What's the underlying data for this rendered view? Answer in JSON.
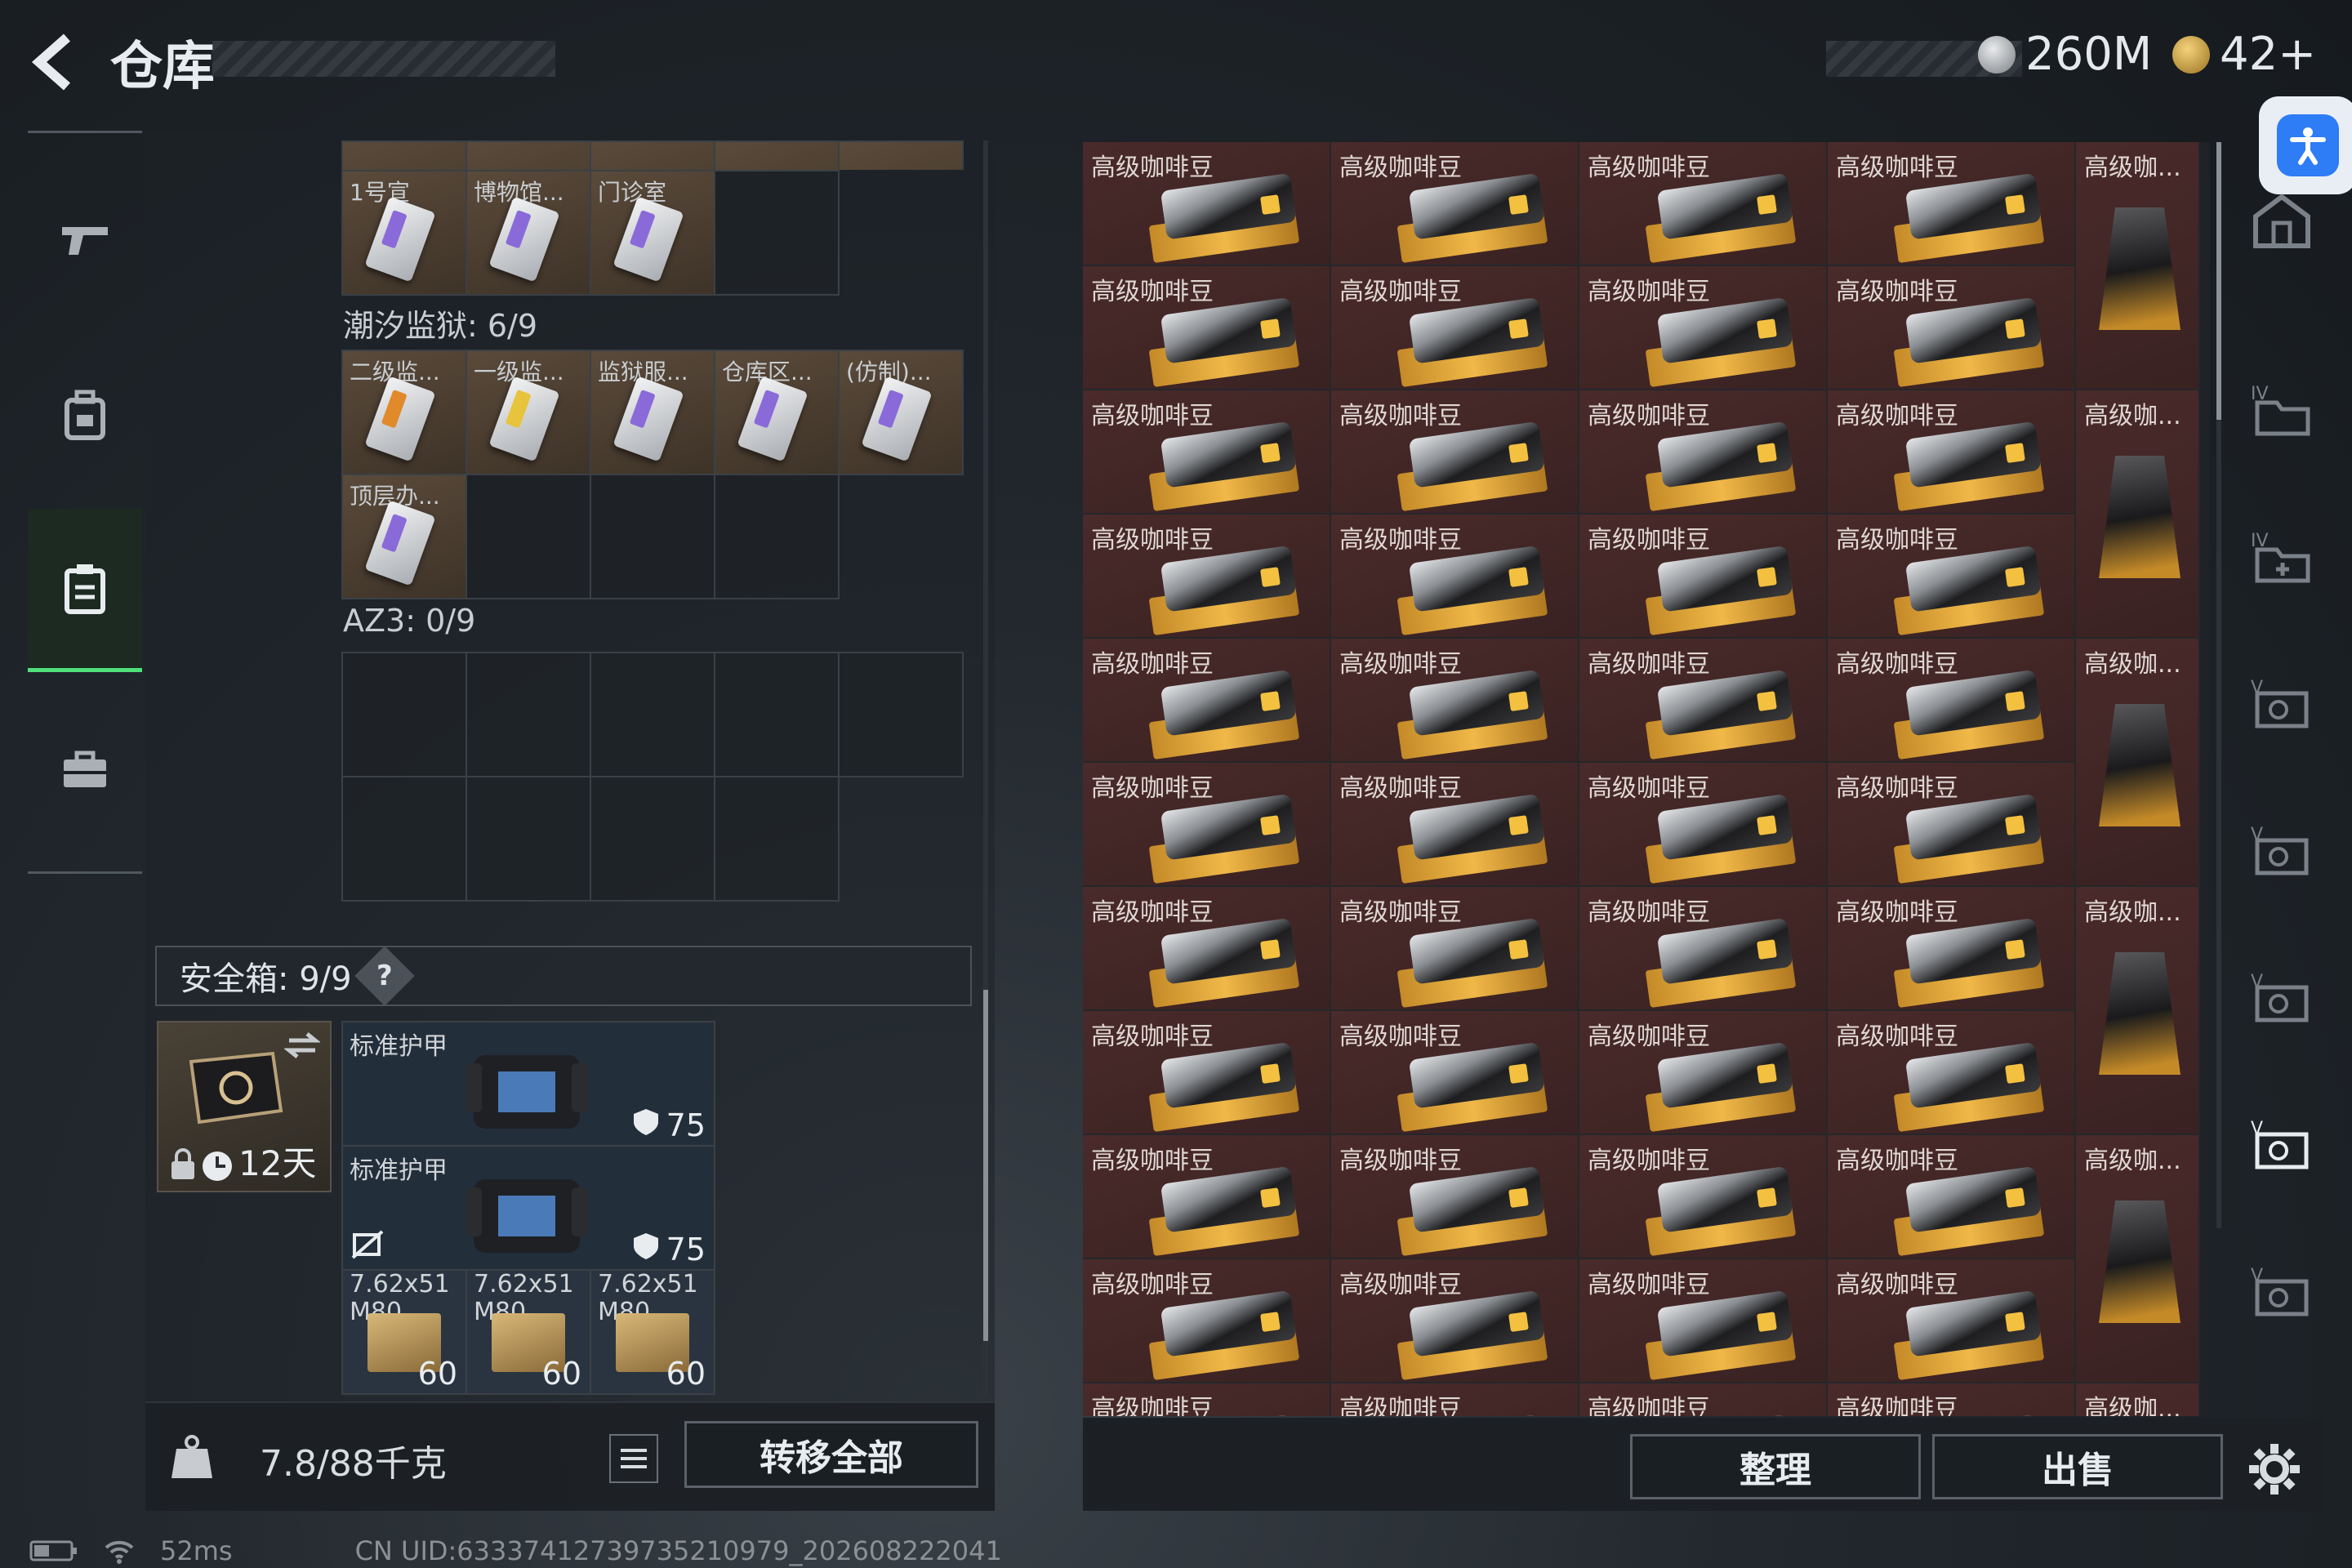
{
  "header": {
    "title": "仓库",
    "currency_1": "260M",
    "currency_2": "42+"
  },
  "left_panel": {
    "row1_cells": [
      "1号宣",
      "博物馆...",
      "门诊室"
    ],
    "prison": {
      "label": "潮汐监狱: 6/9",
      "cells": [
        "二级监...",
        "一级监...",
        "监狱服...",
        "仓库区...",
        "(仿制)...",
        "顶层办..."
      ]
    },
    "az3": {
      "label": "AZ3: 0/9"
    },
    "safe_box": {
      "label": "安全箱: 9/9",
      "help": "?",
      "timer": "12天"
    },
    "safe_items": [
      {
        "name": "标准护甲",
        "durability": "75"
      },
      {
        "name": "标准护甲",
        "durability": "75"
      }
    ],
    "ammo": [
      {
        "name": "7.62x51 M80",
        "count": "60"
      },
      {
        "name": "7.62x51 M80",
        "count": "60"
      },
      {
        "name": "7.62x51 M80",
        "count": "60"
      }
    ],
    "weight": "7.8/88千克",
    "transfer_all": "转移全部"
  },
  "right_panel": {
    "item_label": "高级咖啡豆",
    "item_label_short": "高级咖...",
    "sort": "整理",
    "sell": "出售"
  },
  "status": {
    "ping": "52ms",
    "uid": "CN UID:63337412739735210979_202608222041"
  },
  "colors": {
    "accent_green": "#4fe07a",
    "item_bg": "#4a2a2a",
    "access_blue": "#2e7cf6"
  }
}
